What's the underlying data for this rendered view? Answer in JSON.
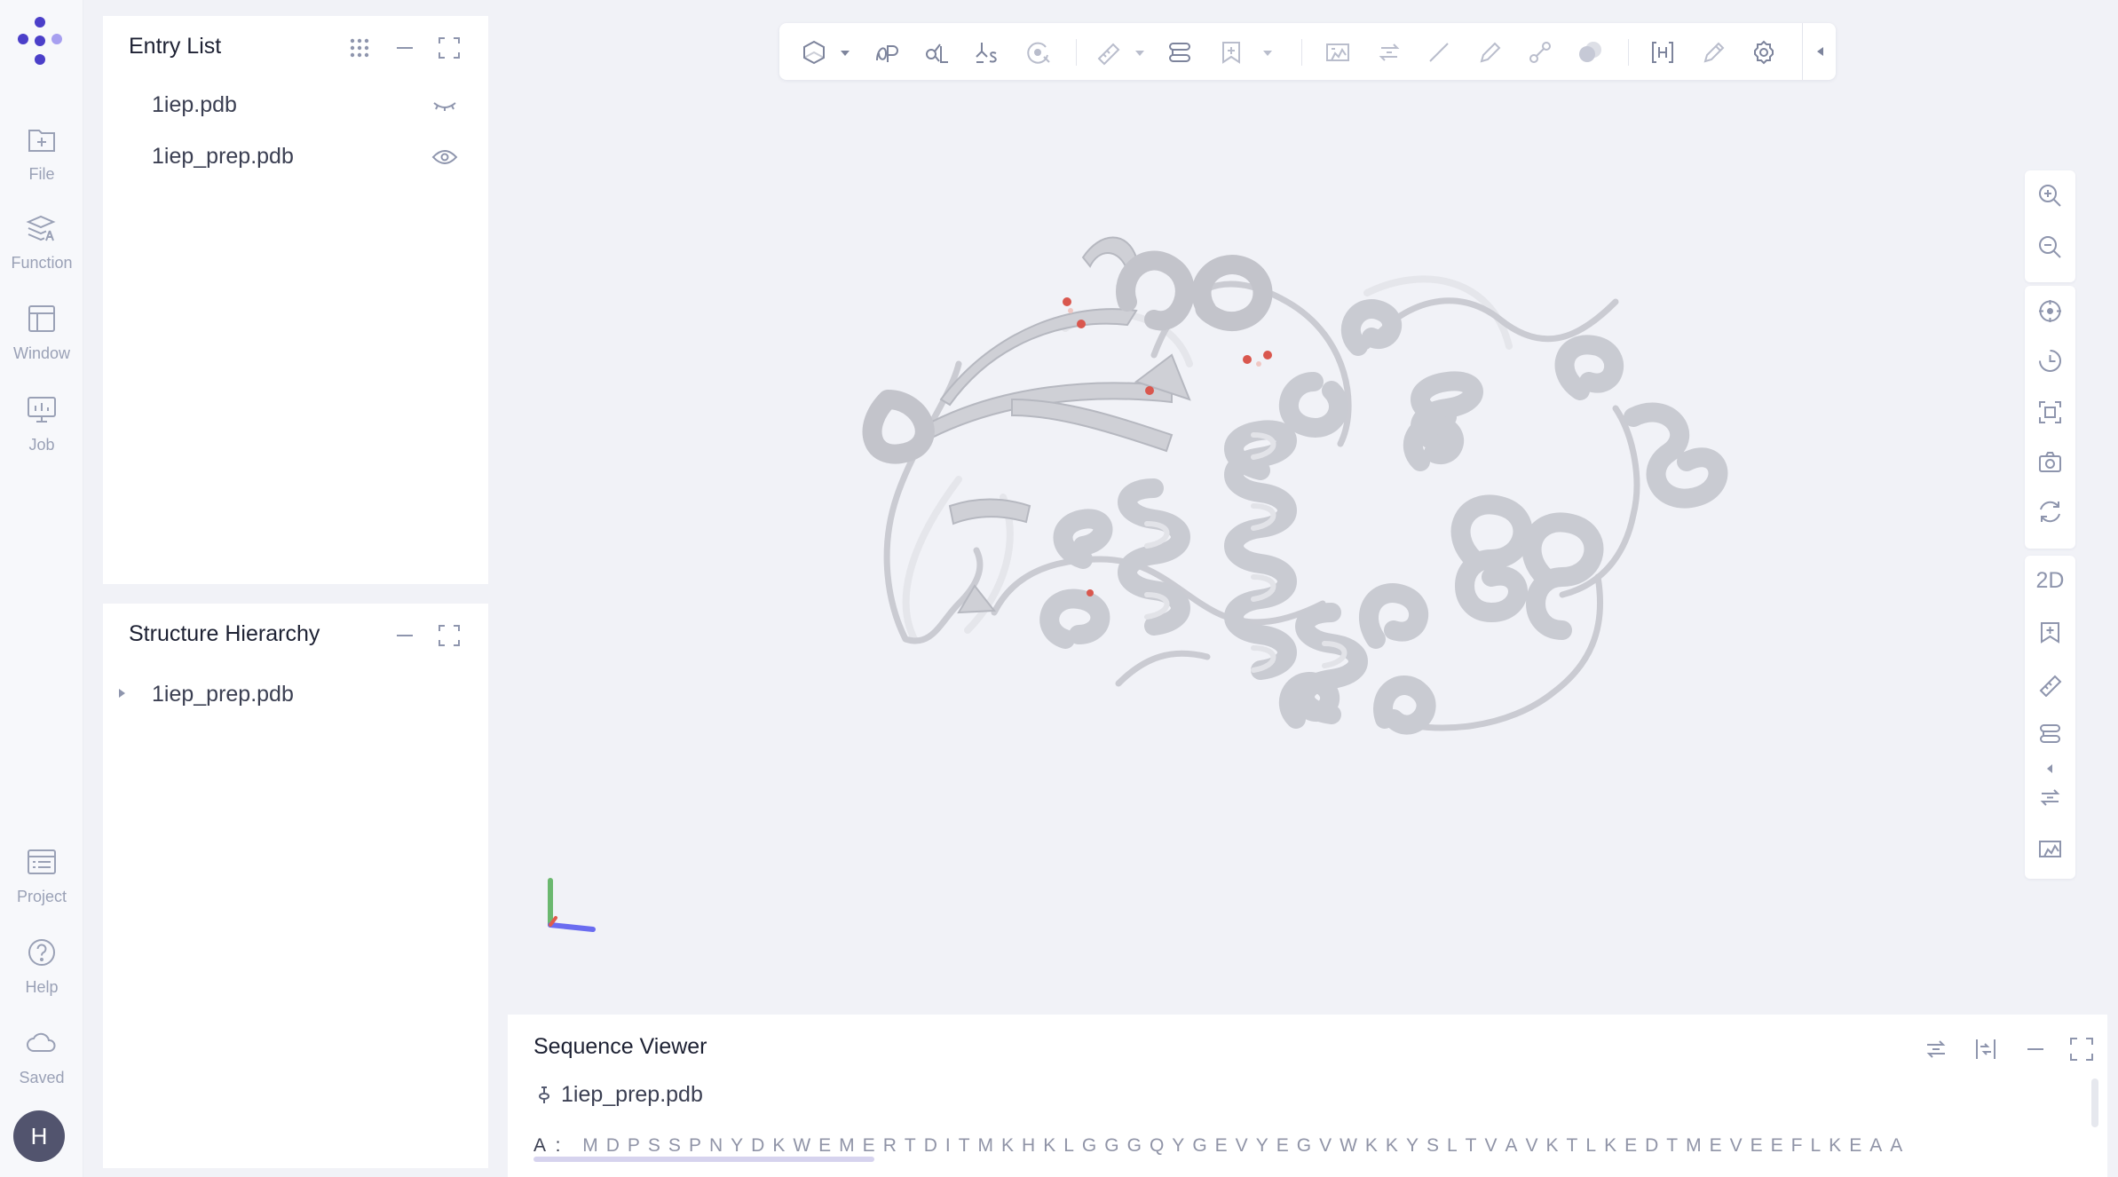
{
  "rail": {
    "items": [
      {
        "label": "File",
        "icon": "file-add-icon"
      },
      {
        "label": "Function",
        "icon": "function-icon"
      },
      {
        "label": "Window",
        "icon": "window-icon"
      },
      {
        "label": "Job",
        "icon": "job-icon"
      }
    ],
    "bottom_items": [
      {
        "label": "Project",
        "icon": "project-icon"
      },
      {
        "label": "Help",
        "icon": "help-icon"
      },
      {
        "label": "Saved",
        "icon": "cloud-icon"
      }
    ],
    "avatar_initial": "H"
  },
  "entry_list": {
    "title": "Entry List",
    "entries": [
      {
        "name": "1iep.pdb",
        "visible": false
      },
      {
        "name": "1iep_prep.pdb",
        "visible": true
      }
    ]
  },
  "structure_hierarchy": {
    "title": "Structure Hierarchy",
    "items": [
      {
        "name": "1iep_prep.pdb"
      }
    ]
  },
  "toolbar": {
    "icons": [
      "style-icon",
      "protein-preparation-icon",
      "ligand-icon",
      "ligand-site-icon",
      "pocket-icon",
      "measure-icon",
      "sequence-icon",
      "bookmark-icon",
      "surface-map-icon",
      "superpose-icon",
      "line-icon",
      "pencil-icon",
      "bond-icon",
      "overlay-icon",
      "hydrogen-icon",
      "edit-icon",
      "settings-icon",
      "collapse-icon"
    ]
  },
  "side_toolbar": {
    "two_d_label": "2D"
  },
  "sequence_viewer": {
    "title": "Sequence Viewer",
    "file": "1iep_prep.pdb",
    "chain_label": "A :",
    "residues": [
      "M",
      "D",
      "P",
      "S",
      "S",
      "P",
      "N",
      "Y",
      "D",
      "K",
      "W",
      "E",
      "M",
      "E",
      "R",
      "T",
      "D",
      "I",
      "T",
      "M",
      "K",
      "H",
      "K",
      "L",
      "G",
      "G",
      "G",
      "Q",
      "Y",
      "G",
      "E",
      "V",
      "Y",
      "E",
      "G",
      "V",
      "W",
      "K",
      "K",
      "Y",
      "S",
      "L",
      "T",
      "V",
      "A",
      "V",
      "K",
      "T",
      "L",
      "K",
      "E",
      "D",
      "T",
      "M",
      "E",
      "V",
      "E",
      "E",
      "F",
      "L",
      "K",
      "E",
      "A",
      "A"
    ]
  },
  "colors": {
    "accent": "#5b4fd6",
    "ribbon": "#c9cbd2",
    "background": "#f1f2f7"
  }
}
